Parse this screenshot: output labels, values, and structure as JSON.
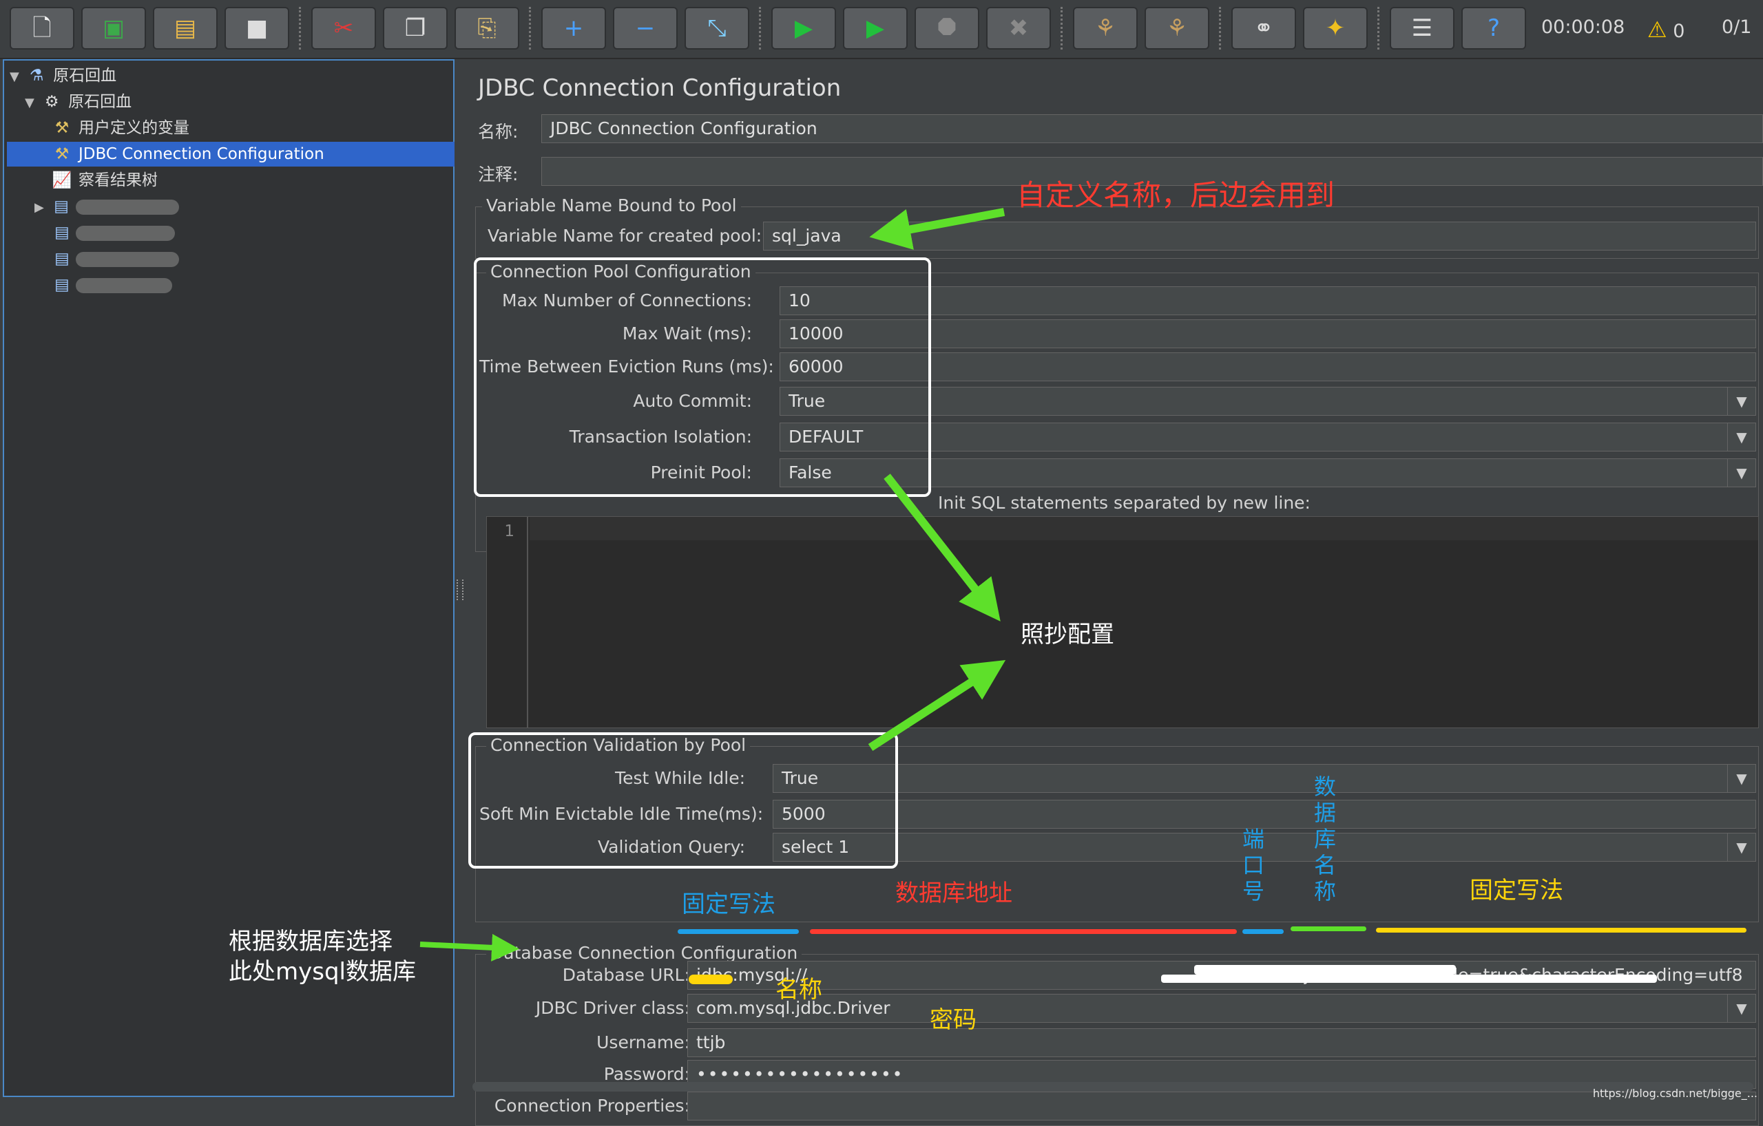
{
  "toolbar": {
    "timer": "00:00:08",
    "warnings": "0",
    "threads": "0/1"
  },
  "tree": {
    "root": "原石回血",
    "thread_group": "原石回血",
    "items": [
      {
        "label": "用户定义的变量"
      },
      {
        "label": "JDBC Connection Configuration"
      },
      {
        "label": "察看结果树"
      }
    ]
  },
  "panel": {
    "title": "JDBC Connection Configuration",
    "name_label": "名称:",
    "name_value": "JDBC Connection Configuration",
    "comment_label": "注释:",
    "comment_value": "",
    "var_group": "Variable Name Bound to Pool",
    "var_label": "Variable Name for created pool:",
    "var_value": "sql_java",
    "pool_group": "Connection Pool Configuration",
    "max_conn_label": "Max Number of Connections:",
    "max_conn_value": "10",
    "max_wait_label": "Max Wait (ms):",
    "max_wait_value": "10000",
    "eviction_label": "Time Between Eviction Runs (ms):",
    "eviction_value": "60000",
    "autocommit_label": "Auto Commit:",
    "autocommit_value": "True",
    "isolation_label": "Transaction Isolation:",
    "isolation_value": "DEFAULT",
    "preinit_label": "Preinit Pool:",
    "preinit_value": "False",
    "init_sql_label": "Init SQL statements separated by new line:",
    "init_sql_line": "1",
    "validation_group": "Connection Validation by Pool",
    "test_idle_label": "Test While Idle:",
    "test_idle_value": "True",
    "soft_min_label": "Soft Min Evictable Idle Time(ms):",
    "soft_min_value": "5000",
    "validation_query_label": "Validation Query:",
    "validation_query_value": "select 1",
    "db_group": "Database Connection Configuration",
    "db_url_label": "Database URL:",
    "db_url_prefix": "jdbc:mysql://",
    "db_url_suffix": "3306/ttjb-test?useUnicode=true&characterEncoding=utf8",
    "driver_label": "JDBC Driver class:",
    "driver_value": "com.mysql.jdbc.Driver",
    "username_label": "Username:",
    "username_value": "ttjb",
    "password_label": "Password:",
    "password_value": "••••••••••••••••••",
    "conn_props_label": "Connection Properties:",
    "conn_props_value": ""
  },
  "annotations": {
    "custom_name": "自定义名称，后边会用到",
    "copy_config": "照抄配置",
    "fixed1": "固定写法",
    "db_address": "数据库地址",
    "port": "端口号",
    "db_name": "数据库名称",
    "fixed2": "固定写法",
    "driver_note_line1": "根据数据库选择",
    "driver_note_line2": "此处mysql数据库",
    "username_note": "名称",
    "password_note": "密码"
  },
  "watermark": "https://blog.csdn.net/bigge_...",
  "colors": {
    "arrow_green": "#5ee02a",
    "anno_red": "#ff3b30",
    "anno_blue": "#1e9fe8",
    "anno_yellow": "#ffd60a",
    "selection": "#2f65ca"
  },
  "icons": [
    "new-file-icon",
    "templates-icon",
    "open-icon",
    "save-icon",
    "cut-icon",
    "copy-icon",
    "paste-icon",
    "expand-icon",
    "collapse-icon",
    "toggle-icon",
    "start-icon",
    "start-no-pause-icon",
    "stop-icon",
    "shutdown-icon",
    "clear-icon",
    "clear-all-icon",
    "search-icon",
    "reset-search-icon",
    "function-helper-icon",
    "help-icon",
    "warning-icon"
  ]
}
